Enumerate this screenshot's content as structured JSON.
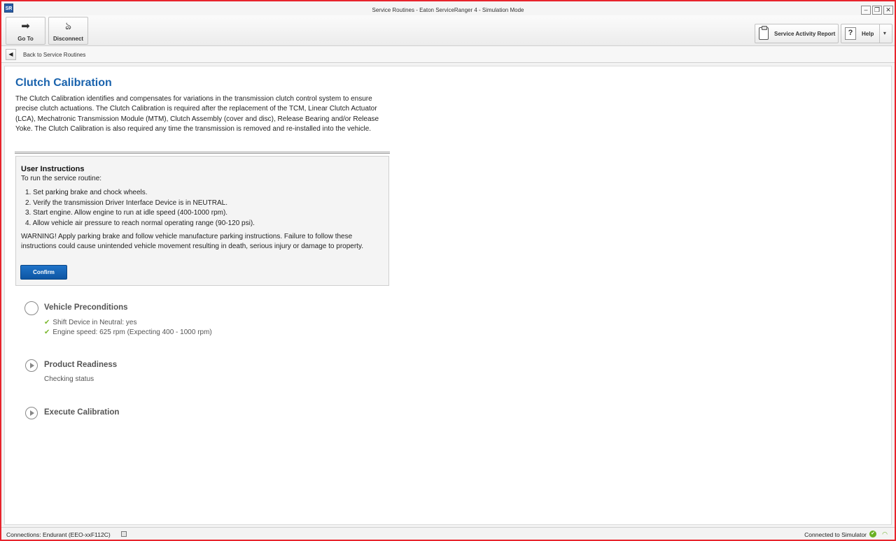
{
  "window": {
    "app_icon": "SR",
    "title": "Service Routines - Eaton ServiceRanger 4 - Simulation Mode",
    "controls": {
      "minimize": "–",
      "restore": "❐",
      "close": "✕"
    }
  },
  "toolbar": {
    "goto_label": "Go To",
    "goto_icon": "➡",
    "disconnect_label": "Disconnect",
    "disconnect_icon": "ঌ",
    "report_label": "Service Activity Report",
    "help_label": "Help",
    "help_icon": "?",
    "help_caret": "▾"
  },
  "nav": {
    "back_icon": "◀",
    "back_label": "Back to Service Routines"
  },
  "page": {
    "title": "Clutch Calibration",
    "description": "The Clutch Calibration identifies and compensates for variations in the transmission clutch control system to ensure precise clutch actuations. The Clutch Calibration is required after the replacement of the TCM, Linear Clutch Actuator (LCA), Mechatronic Transmission Module (MTM), Clutch Assembly (cover and disc), Release Bearing and/or Release Yoke.  The Clutch Calibration is also required any time the transmission is removed and re-installed into the vehicle."
  },
  "instructions": {
    "title": "User Instructions",
    "subtitle": "To run the service routine:",
    "steps": [
      "1. Set parking brake and chock wheels.",
      "2. Verify the transmission Driver Interface Device is in NEUTRAL.",
      "3. Start engine. Allow engine to run at idle speed (400-1000 rpm).",
      "4. Allow vehicle air pressure to reach normal operating range (90-120 psi)."
    ],
    "warning": "WARNING!  Apply parking brake and follow vehicle manufacture parking instructions. Failure to follow these instructions could cause unintended vehicle movement resulting in death, serious injury or damage to property.",
    "confirm_label": "Confirm"
  },
  "steps": {
    "preconditions": {
      "title": "Vehicle Preconditions",
      "checks": [
        "Shift Device in Neutral: yes",
        "Engine speed: 625 rpm (Expecting 400 - 1000 rpm)"
      ],
      "check_icon": "✔"
    },
    "readiness": {
      "title": "Product Readiness",
      "status": "Checking status"
    },
    "execute": {
      "title": "Execute Calibration"
    }
  },
  "status": {
    "connections": "Connections: Endurant (EEO-xxF112C)",
    "connected": "Connected to Simulator",
    "ok_icon": "✔",
    "signal_icon": "◠"
  }
}
